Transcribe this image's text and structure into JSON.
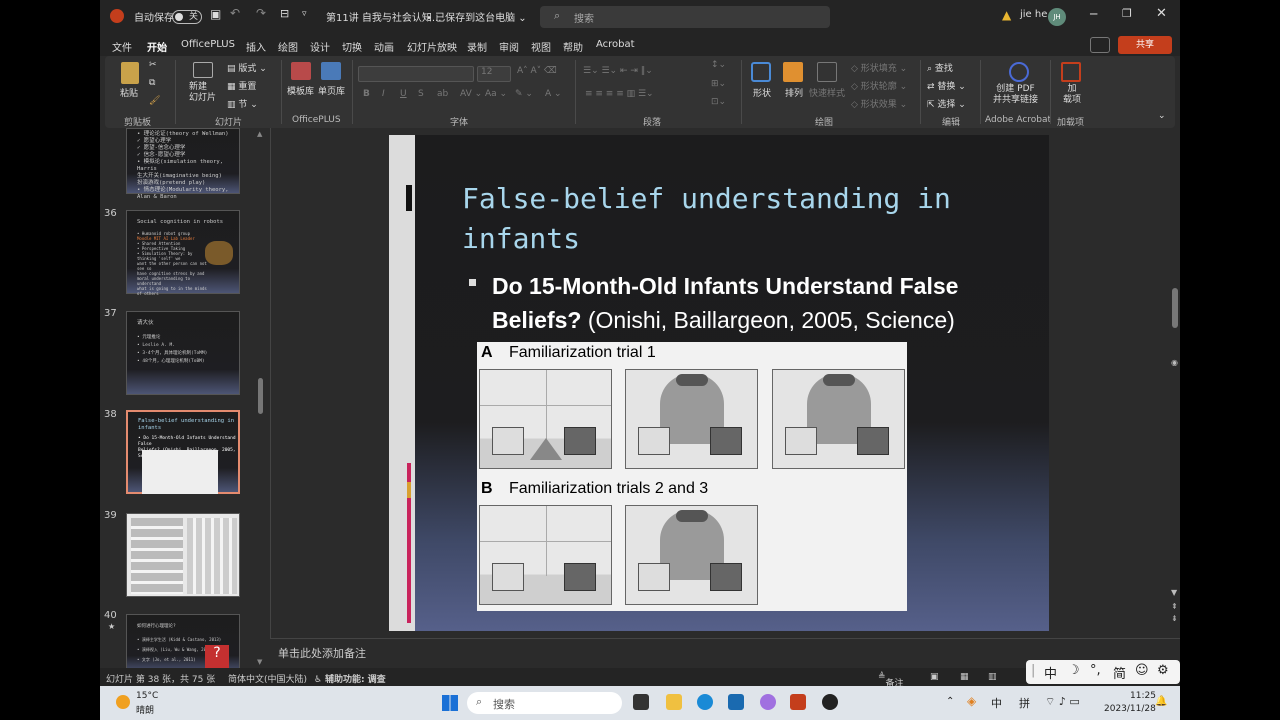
{
  "titlebar": {
    "autosave_label": "自动保存",
    "autosave_state": "关",
    "doc_title": "第11讲 自我与社会认知...",
    "save_status": "• 已保存到这台电脑 ⌄",
    "search_placeholder": "搜索",
    "user_name": "jie he",
    "user_initials": "JH"
  },
  "menu": {
    "items": [
      "文件",
      "开始",
      "OfficePLUS",
      "插入",
      "绘图",
      "设计",
      "切换",
      "动画",
      "幻灯片放映",
      "录制",
      "审阅",
      "视图",
      "帮助",
      "Acrobat"
    ],
    "active": "开始",
    "share_label": "共享"
  },
  "ribbon": {
    "clipboard": {
      "paste": "粘贴",
      "group": "剪贴板"
    },
    "slides": {
      "new_slide": "新建\n幻灯片",
      "layout": "版式",
      "reset": "重置",
      "section": "节",
      "group": "幻灯片"
    },
    "officeplus": {
      "template": "模板库",
      "single": "单页库",
      "group": "OfficePLUS"
    },
    "font": {
      "group": "字体",
      "size": "12"
    },
    "paragraph": {
      "group": "段落"
    },
    "drawing": {
      "shapes": "形状",
      "arrange": "排列",
      "quick_styles": "快速样式",
      "fill": "形状填充",
      "outline": "形状轮廓",
      "effects": "形状效果",
      "group": "绘图"
    },
    "editing": {
      "find": "查找",
      "replace": "替换",
      "select": "选择",
      "group": "编辑"
    },
    "acrobat": {
      "create_pdf": "创建 PDF\n并共享链接",
      "group": "Adobe Acrobat"
    },
    "addins": {
      "addins": "加\n载项",
      "group": "加载项"
    }
  },
  "thumbnails": [
    {
      "num": "",
      "title": "",
      "lines": [
        "• 理论论证(theory of Wellman)",
        "  ✓ 愿望心理学",
        "  ✓ 愿望-信念心理学",
        "  ✓ 信念-愿望心理学",
        "• 模拟论(simulation theory, Harris",
        "  生大开关(imaginative being)",
        "  扮演游戏(pretend play)",
        "• 情态理论(Modularity theory, Alan & Baron"
      ]
    },
    {
      "num": "36",
      "title": "Social cognition in robots",
      "lines": [
        "• Humanoid robot group",
        "  Moodle MIT AI Lab Leader",
        "• Shared Attention",
        "• Perspective Taking",
        "• Simulation Theory: by thinking 'self' we",
        "  want the other person can not see so",
        "  have cognitive stress by and",
        "  moral understanding to understand",
        "  what is going to in the minds of others"
      ]
    },
    {
      "num": "37",
      "title": "请大伙",
      "lines": [
        "• 元理推论",
        "• Leslie A. M.",
        "• 3-4个月，具体理论机制(ToMM)",
        "• 48个月，心理理论机制(ToBM)"
      ]
    },
    {
      "num": "38",
      "title": "False-belief understanding in infants",
      "lines": [
        "• Do 15-Month-Old Infants Understand False",
        "  Beliefs? (Onishi, Baillargeon, 2005, Science)"
      ]
    },
    {
      "num": "39",
      "title": "",
      "lines": []
    },
    {
      "num": "40",
      "title": "如何进行心理理论?",
      "lines": [
        "• 演绎主学生活 (Kidd & Castano, 2013)",
        "• 演绎视入 (Liu, Wu & Wang, 2008)",
        "• 文字 (Jo, et al., 2011)"
      ]
    }
  ],
  "slide": {
    "title": "False-belief understanding in infants",
    "bullet_bold": "Do 15-Month-Old Infants Understand False Beliefs?",
    "bullet_normal": " (Onishi, Baillargeon, 2005, Science)",
    "figure": {
      "label_a_letter": "A",
      "label_a": "Familiarization trial 1",
      "label_b_letter": "B",
      "label_b": "Familiarization trials 2 and 3"
    }
  },
  "notes_placeholder": "单击此处添加备注",
  "statusbar": {
    "slide_info": "幻灯片 第 38 张，共 75 张",
    "language": "简体中文(中国大陆)",
    "accessibility": "辅助功能: 调查",
    "notes": "备注"
  },
  "ime": {
    "mode": "中",
    "punct": "°,",
    "simplified": "简"
  },
  "taskbar": {
    "temp": "15°C",
    "weather": "晴朗",
    "search": "搜索",
    "lang1": "中",
    "lang2": "拼",
    "time": "11:25",
    "date": "2023/11/28"
  }
}
